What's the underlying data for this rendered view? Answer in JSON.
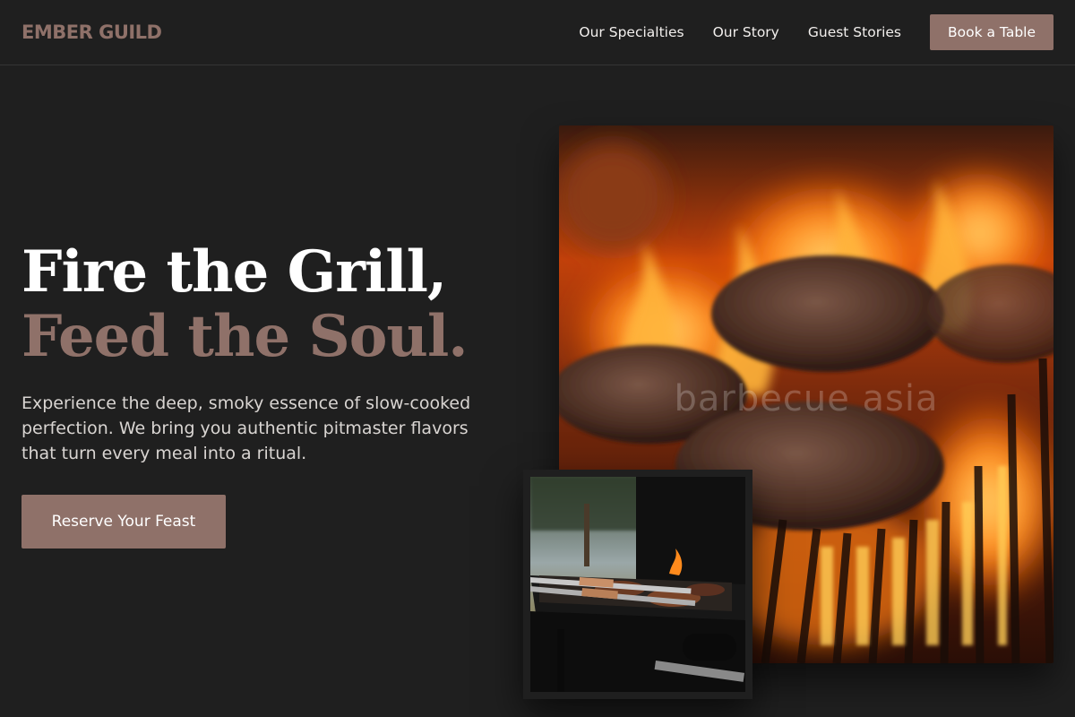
{
  "nav": {
    "logo": "EMBER GUILD",
    "links": [
      {
        "label": "Our Specialties"
      },
      {
        "label": "Our Story"
      },
      {
        "label": "Guest Stories"
      }
    ],
    "cta_label": "Book a Table"
  },
  "hero": {
    "title_line1": "Fire the Grill,",
    "title_line2": "Feed the Soul.",
    "description": "Experience the deep, smoky essence of slow-cooked perfection. We bring you authentic pitmaster flavors that turn every meal into a ritual.",
    "cta_label": "Reserve Your Feast"
  },
  "images": {
    "main_watermark": "barbecue asia"
  },
  "colors": {
    "background": "#1f1f1f",
    "accent": "#8f7169",
    "text": "#ffffff"
  }
}
